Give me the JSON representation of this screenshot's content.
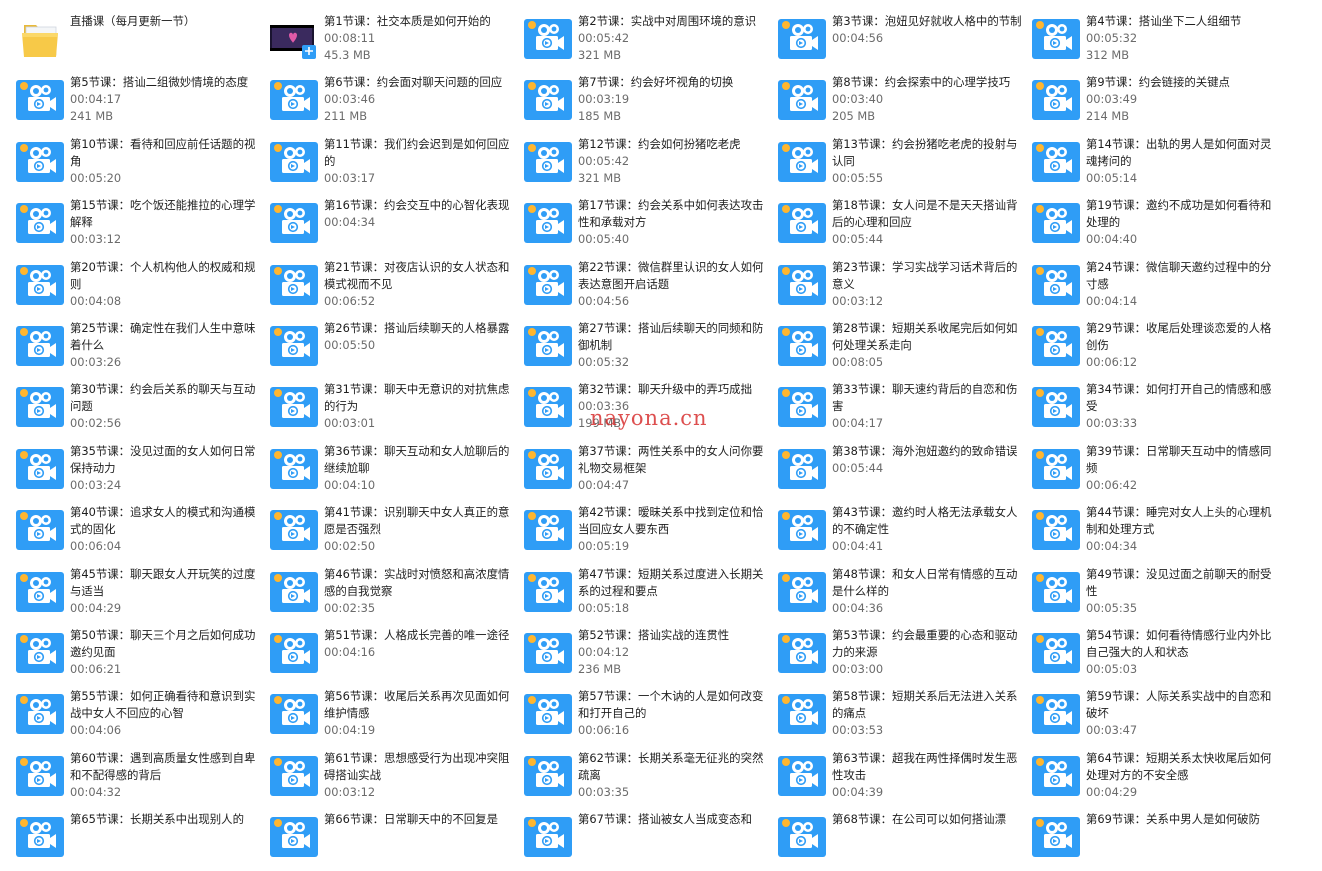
{
  "colors": {
    "icon_blue": "#2f9df6",
    "icon_light": "#ffffff",
    "badge_orange": "#ffb62f",
    "folder_yellow": "#f7c948",
    "watermark": "#d62828"
  },
  "watermark": "nayona.cn",
  "items": [
    {
      "kind": "folder",
      "icon": "folder-icon",
      "title": "直播课（每月更新一节）"
    },
    {
      "kind": "video-thumbnail",
      "icon": "video-thumbnail-icon",
      "title": "第1节课：社交本质是如何开始的",
      "duration": "00:08:11",
      "size": "45.3 MB"
    },
    {
      "kind": "video",
      "icon": "video-file-icon",
      "title": "第2节课：实战中对周围环境的意识",
      "duration": "00:05:42",
      "size": "321 MB"
    },
    {
      "kind": "video",
      "icon": "video-file-icon",
      "title": "第3节课：泡妞见好就收人格中的节制",
      "duration": "00:04:56"
    },
    {
      "kind": "video",
      "icon": "video-file-icon",
      "title": "第4节课：搭讪坐下二人组细节",
      "duration": "00:05:32",
      "size": "312 MB"
    },
    {
      "kind": "video",
      "icon": "video-file-icon",
      "title": "第5节课：搭讪二组微妙情境的态度",
      "duration": "00:04:17",
      "size": "241 MB"
    },
    {
      "kind": "video",
      "icon": "video-file-icon",
      "title": "第6节课：约会面对聊天问题的回应",
      "duration": "00:03:46",
      "size": "211 MB"
    },
    {
      "kind": "video",
      "icon": "video-file-icon",
      "title": "第7节课：约会好坏视角的切换",
      "duration": "00:03:19",
      "size": "185 MB"
    },
    {
      "kind": "video",
      "icon": "video-file-icon",
      "title": "第8节课：约会探索中的心理学技巧",
      "duration": "00:03:40",
      "size": "205 MB"
    },
    {
      "kind": "video",
      "icon": "video-file-icon",
      "title": "第9节课：约会链接的关键点",
      "duration": "00:03:49",
      "size": "214 MB"
    },
    {
      "kind": "video",
      "icon": "video-file-icon",
      "title": "第10节课：看待和回应前任话题的视角",
      "duration": "00:05:20"
    },
    {
      "kind": "video",
      "icon": "video-file-icon",
      "title": "第11节课：我们约会迟到是如何回应的",
      "duration": "00:03:17"
    },
    {
      "kind": "video",
      "icon": "video-file-icon",
      "title": "第12节课：约会如何扮猪吃老虎",
      "duration": "00:05:42",
      "size": "321 MB"
    },
    {
      "kind": "video",
      "icon": "video-file-icon",
      "title": "第13节课：约会扮猪吃老虎的投射与认同",
      "duration": "00:05:55"
    },
    {
      "kind": "video",
      "icon": "video-file-icon",
      "title": "第14节课：出轨的男人是如何面对灵魂拷问的",
      "duration": "00:05:14"
    },
    {
      "kind": "video",
      "icon": "video-file-icon",
      "title": "第15节课：吃个饭还能推拉的心理学解释",
      "duration": "00:03:12"
    },
    {
      "kind": "video",
      "icon": "video-file-icon",
      "title": "第16节课：约会交互中的心智化表现",
      "duration": "00:04:34"
    },
    {
      "kind": "video",
      "icon": "video-file-icon",
      "title": "第17节课：约会关系中如何表达攻击性和承载对方",
      "duration": "00:05:40"
    },
    {
      "kind": "video",
      "icon": "video-file-icon",
      "title": "第18节课：女人问是不是天天搭讪背后的心理和回应",
      "duration": "00:05:44"
    },
    {
      "kind": "video",
      "icon": "video-file-icon",
      "title": "第19节课：邀约不成功是如何看待和处理的",
      "duration": "00:04:40"
    },
    {
      "kind": "video",
      "icon": "video-file-icon",
      "title": "第20节课：个人机构他人的权威和规则",
      "duration": "00:04:08"
    },
    {
      "kind": "video",
      "icon": "video-file-icon",
      "title": "第21节课：对夜店认识的女人状态和模式视而不见",
      "duration": "00:06:52"
    },
    {
      "kind": "video",
      "icon": "video-file-icon",
      "title": "第22节课：微信群里认识的女人如何表达意图开启话题",
      "duration": "00:04:56"
    },
    {
      "kind": "video",
      "icon": "video-file-icon",
      "title": "第23节课：学习实战学习话术背后的意义",
      "duration": "00:03:12"
    },
    {
      "kind": "video",
      "icon": "video-file-icon",
      "title": "第24节课：微信聊天邀约过程中的分寸感",
      "duration": "00:04:14"
    },
    {
      "kind": "video",
      "icon": "video-file-icon",
      "title": "第25节课：确定性在我们人生中意味着什么",
      "duration": "00:03:26"
    },
    {
      "kind": "video",
      "icon": "video-file-icon",
      "title": "第26节课：搭讪后续聊天的人格暴露",
      "duration": "00:05:50"
    },
    {
      "kind": "video",
      "icon": "video-file-icon",
      "title": "第27节课：搭讪后续聊天的同频和防御机制",
      "duration": "00:05:32"
    },
    {
      "kind": "video",
      "icon": "video-file-icon",
      "title": "第28节课：短期关系收尾完后如何如何处理关系走向",
      "duration": "00:08:05"
    },
    {
      "kind": "video",
      "icon": "video-file-icon",
      "title": "第29节课：收尾后处理谈恋爱的人格创伤",
      "duration": "00:06:12"
    },
    {
      "kind": "video",
      "icon": "video-file-icon",
      "title": "第30节课：约会后关系的聊天与互动问题",
      "duration": "00:02:56"
    },
    {
      "kind": "video",
      "icon": "video-file-icon",
      "title": "第31节课：聊天中无意识的对抗焦虑的行为",
      "duration": "00:03:01"
    },
    {
      "kind": "video",
      "icon": "video-file-icon",
      "title": "第32节课：聊天升级中的弄巧成拙",
      "duration": "00:03:36",
      "size": "199 MB"
    },
    {
      "kind": "video",
      "icon": "video-file-icon",
      "title": "第33节课：聊天速约背后的自恋和伤害",
      "duration": "00:04:17"
    },
    {
      "kind": "video",
      "icon": "video-file-icon",
      "title": "第34节课：如何打开自己的情感和感受",
      "duration": "00:03:33"
    },
    {
      "kind": "video",
      "icon": "video-file-icon",
      "title": "第35节课：没见过面的女人如何日常保持动力",
      "duration": "00:03:24"
    },
    {
      "kind": "video",
      "icon": "video-file-icon",
      "title": "第36节课：聊天互动和女人尬聊后的继续尬聊",
      "duration": "00:04:10"
    },
    {
      "kind": "video",
      "icon": "video-file-icon",
      "title": "第37节课：两性关系中的女人问你要礼物交易框架",
      "duration": "00:04:47"
    },
    {
      "kind": "video",
      "icon": "video-file-icon",
      "title": "第38节课：海外泡妞邀约的致命错误",
      "duration": "00:05:44"
    },
    {
      "kind": "video",
      "icon": "video-file-icon",
      "title": "第39节课：日常聊天互动中的情感同频",
      "duration": "00:06:42"
    },
    {
      "kind": "video",
      "icon": "video-file-icon",
      "title": "第40节课：追求女人的模式和沟通模式的固化",
      "duration": "00:06:04"
    },
    {
      "kind": "video",
      "icon": "video-file-icon",
      "title": "第41节课：识别聊天中女人真正的意愿是否强烈",
      "duration": "00:02:50"
    },
    {
      "kind": "video",
      "icon": "video-file-icon",
      "title": "第42节课：暧昧关系中找到定位和恰当回应女人要东西",
      "duration": "00:05:19"
    },
    {
      "kind": "video",
      "icon": "video-file-icon",
      "title": "第43节课：邀约时人格无法承载女人的不确定性",
      "duration": "00:04:41"
    },
    {
      "kind": "video",
      "icon": "video-file-icon",
      "title": "第44节课：睡完对女人上头的心理机制和处理方式",
      "duration": "00:04:34"
    },
    {
      "kind": "video",
      "icon": "video-file-icon",
      "title": "第45节课：聊天跟女人开玩笑的过度与适当",
      "duration": "00:04:29"
    },
    {
      "kind": "video",
      "icon": "video-file-icon",
      "title": "第46节课：实战时对愤怒和高浓度情感的自我觉察",
      "duration": "00:02:35"
    },
    {
      "kind": "video",
      "icon": "video-file-icon",
      "title": "第47节课：短期关系过度进入长期关系的过程和要点",
      "duration": "00:05:18"
    },
    {
      "kind": "video",
      "icon": "video-file-icon",
      "title": "第48节课：和女人日常有情感的互动是什么样的",
      "duration": "00:04:36"
    },
    {
      "kind": "video",
      "icon": "video-file-icon",
      "title": "第49节课：没见过面之前聊天的耐受性",
      "duration": "00:05:35"
    },
    {
      "kind": "video",
      "icon": "video-file-icon",
      "title": "第50节课：聊天三个月之后如何成功邀约见面",
      "duration": "00:06:21"
    },
    {
      "kind": "video",
      "icon": "video-file-icon",
      "title": "第51节课：人格成长完善的唯一途径",
      "duration": "00:04:16"
    },
    {
      "kind": "video",
      "icon": "video-file-icon",
      "title": "第52节课：搭讪实战的连贯性",
      "duration": "00:04:12",
      "size": "236 MB"
    },
    {
      "kind": "video",
      "icon": "video-file-icon",
      "title": "第53节课：约会最重要的心态和驱动力的来源",
      "duration": "00:03:00"
    },
    {
      "kind": "video",
      "icon": "video-file-icon",
      "title": "第54节课：如何看待情感行业内外比自己强大的人和状态",
      "duration": "00:05:03"
    },
    {
      "kind": "video",
      "icon": "video-file-icon",
      "title": "第55节课：如何正确看待和意识到实战中女人不回应的心智",
      "duration": "00:04:06"
    },
    {
      "kind": "video",
      "icon": "video-file-icon",
      "title": "第56节课：收尾后关系再次见面如何维护情感",
      "duration": "00:04:19"
    },
    {
      "kind": "video",
      "icon": "video-file-icon",
      "title": "第57节课：一个木讷的人是如何改变和打开自己的",
      "duration": "00:06:16"
    },
    {
      "kind": "video",
      "icon": "video-file-icon",
      "title": "第58节课：短期关系后无法进入关系的痛点",
      "duration": "00:03:53"
    },
    {
      "kind": "video",
      "icon": "video-file-icon",
      "title": "第59节课：人际关系实战中的自恋和破坏",
      "duration": "00:03:47"
    },
    {
      "kind": "video",
      "icon": "video-file-icon",
      "title": "第60节课：遇到高质量女性感到自卑和不配得感的背后",
      "duration": "00:04:32"
    },
    {
      "kind": "video",
      "icon": "video-file-icon",
      "title": "第61节课：思想感受行为出现冲突阻碍搭讪实战",
      "duration": "00:03:12"
    },
    {
      "kind": "video",
      "icon": "video-file-icon",
      "title": "第62节课：长期关系毫无征兆的突然疏离",
      "duration": "00:03:35"
    },
    {
      "kind": "video",
      "icon": "video-file-icon",
      "title": "第63节课：超我在两性择偶时发生恶性攻击",
      "duration": "00:04:39"
    },
    {
      "kind": "video",
      "icon": "video-file-icon",
      "title": "第64节课：短期关系太快收尾后如何处理对方的不安全感",
      "duration": "00:04:29"
    },
    {
      "kind": "video",
      "icon": "video-file-icon",
      "title": "第65节课：长期关系中出现别人的"
    },
    {
      "kind": "video",
      "icon": "video-file-icon",
      "title": "第66节课：日常聊天中的不回复是"
    },
    {
      "kind": "video",
      "icon": "video-file-icon",
      "title": "第67节课：搭讪被女人当成变态和"
    },
    {
      "kind": "video",
      "icon": "video-file-icon",
      "title": "第68节课：在公司可以如何搭讪漂"
    },
    {
      "kind": "video",
      "icon": "video-file-icon",
      "title": "第69节课：关系中男人是如何破防"
    }
  ]
}
